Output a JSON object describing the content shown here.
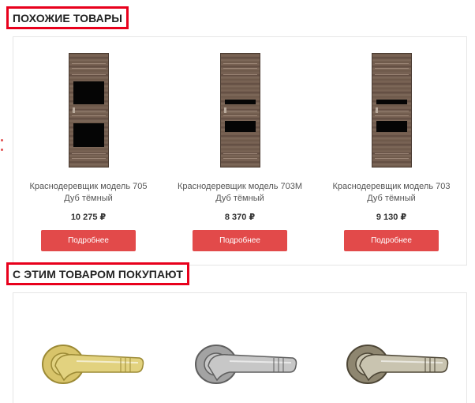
{
  "sections": {
    "similar_title": "ПОХОЖИЕ ТОВАРЫ",
    "also_buy_title": "С ЭТИМ ТОВАРОМ ПОКУПАЮТ"
  },
  "products": [
    {
      "name": "Краснодеревщик модель 705",
      "color": "Дуб тёмный",
      "price": "10 275 ₽",
      "button": "Подробнее",
      "glass": "two-large"
    },
    {
      "name": "Краснодеревщик модель 703M",
      "color": "Дуб тёмный",
      "price": "8 370 ₽",
      "button": "Подробнее",
      "glass": "two-small"
    },
    {
      "name": "Краснодеревщик модель 703",
      "color": "Дуб тёмный",
      "price": "9 130 ₽",
      "button": "Подробнее",
      "glass": "two-small"
    }
  ],
  "handles": [
    {
      "finish": "gold",
      "colors": {
        "rose": "#d8c46a",
        "lever": "#e2d27f",
        "shadow": "#9c8a35"
      }
    },
    {
      "finish": "satin-chrome",
      "colors": {
        "rose": "#a3a3a3",
        "lever": "#c7c7c7",
        "shadow": "#5f5f5f"
      }
    },
    {
      "finish": "antique-bronze",
      "colors": {
        "rose": "#8e8670",
        "lever": "#c9c4b0",
        "shadow": "#4d4636"
      }
    }
  ],
  "colors": {
    "accent_border": "#e8001c",
    "button_bg": "#e24a4a"
  }
}
